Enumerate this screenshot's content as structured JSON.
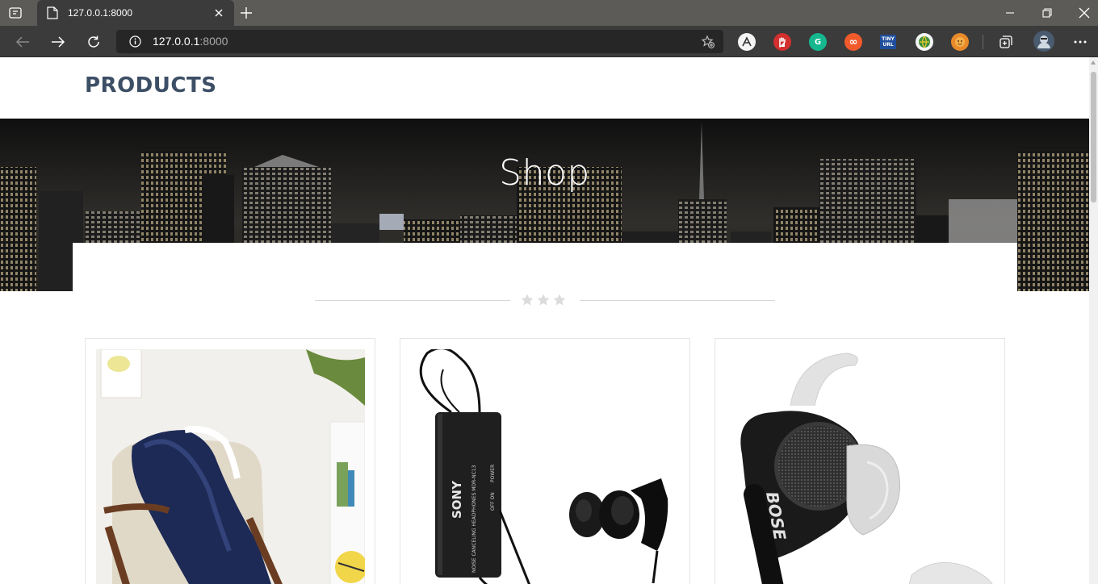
{
  "browser": {
    "tab_title": "127.0.0.1:8000",
    "url_host": "127.0.0.1",
    "url_port": ":8000",
    "extensions": [
      {
        "name": "ext-a-icon",
        "label": "A",
        "color": "#f4f4f4"
      },
      {
        "name": "ext-hand-icon",
        "label": "",
        "color": "#d32f2f"
      },
      {
        "name": "grammarly-icon",
        "label": "G",
        "color": "#15b78f"
      },
      {
        "name": "ext-infinity-icon",
        "label": "∞",
        "color": "#f15a2b"
      },
      {
        "name": "tinyurl-icon",
        "label": "TINY URL",
        "color": "#1f4e9d"
      },
      {
        "name": "ext-globe-icon",
        "label": "",
        "color": "#f4f4f4"
      },
      {
        "name": "ext-face-icon",
        "label": "",
        "color": "#e88a2a"
      }
    ]
  },
  "site": {
    "brand": "PRODUCTS",
    "hero_title": "Shop"
  },
  "products": [
    {
      "name": "blanket-chair",
      "image": "blanket on chair"
    },
    {
      "name": "sony-headphones",
      "image": "Sony noise canceling earphones"
    },
    {
      "name": "bose-earbuds",
      "image": "Bose earbuds"
    }
  ],
  "colors": {
    "brand": "#3d4f66",
    "chrome_dark": "#3b3b3b",
    "tabbar": "#5d5b58"
  }
}
